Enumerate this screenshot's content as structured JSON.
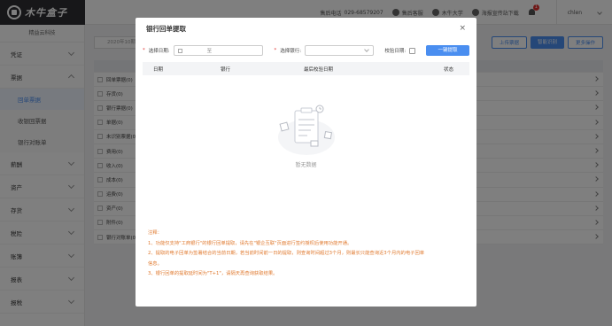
{
  "topbar": {
    "logo_text": "木牛盒子",
    "items": [
      {
        "label": "售后电话",
        "value": "029-68579207"
      },
      {
        "label": "售后客服"
      },
      {
        "label": "木牛大学"
      },
      {
        "label": "海报宣传站下载"
      }
    ],
    "notification_count": "1",
    "user": "chlen"
  },
  "sidebar": {
    "company": "精益云科技",
    "menu": [
      {
        "label": "凭证",
        "open": false
      },
      {
        "label": "票据",
        "open": true
      },
      {
        "label": "回单票据",
        "sub": true,
        "active": true
      },
      {
        "label": "收银回票据",
        "sub": true
      },
      {
        "label": "银行对账单",
        "sub": true
      },
      {
        "label": "薪酬",
        "open": false
      },
      {
        "label": "资产",
        "open": false
      },
      {
        "label": "存货",
        "open": false
      },
      {
        "label": "税险",
        "open": false
      },
      {
        "label": "账簿",
        "open": false
      },
      {
        "label": "报表",
        "open": false
      },
      {
        "label": "报税",
        "open": false
      }
    ]
  },
  "main": {
    "period": "2020年10期",
    "buttons": [
      "上传票据",
      "智能识别",
      "更多操作"
    ],
    "list_rows": [
      "回单票据(0)",
      "存货(0)",
      "银行票据(0)",
      "单据(0)",
      "未识别票据(0)",
      "费用(0)",
      "收入(0)",
      "成本(0)",
      "运费(0)",
      "资产(0)",
      "附件(0)",
      "银行对账单(0)"
    ]
  },
  "modal": {
    "title": "银行回单提取",
    "close": "×",
    "filter": {
      "date_label": "选择日期:",
      "date_to": "至",
      "bank_label": "选择银行:",
      "verify_label": "校验日期:",
      "fetch_button": "一键提取",
      "required_mark": "*"
    },
    "table_headers": [
      "日期",
      "银行",
      "最后校验日期",
      "状态"
    ],
    "empty_text": "暂无数据",
    "notes": [
      "注释：",
      "1、功能仅支持\"工商银行\"的银行回单提取，请先在\"银企互联\"页面进行签约授权后使用功能开通。",
      "2、提取的电子回单为签署结合的当前日期，若当前时间前一日的提取，则查询时间超过3个月，则最长只能查询近3个月内的电子回单",
      "信息。",
      "3、银行回单的提取延时间为\"T+1\"，请隔天再查询获取结果。"
    ]
  },
  "colors": {
    "accent": "#4a8ef0",
    "note": "#e0792e",
    "danger": "#e0312e"
  }
}
